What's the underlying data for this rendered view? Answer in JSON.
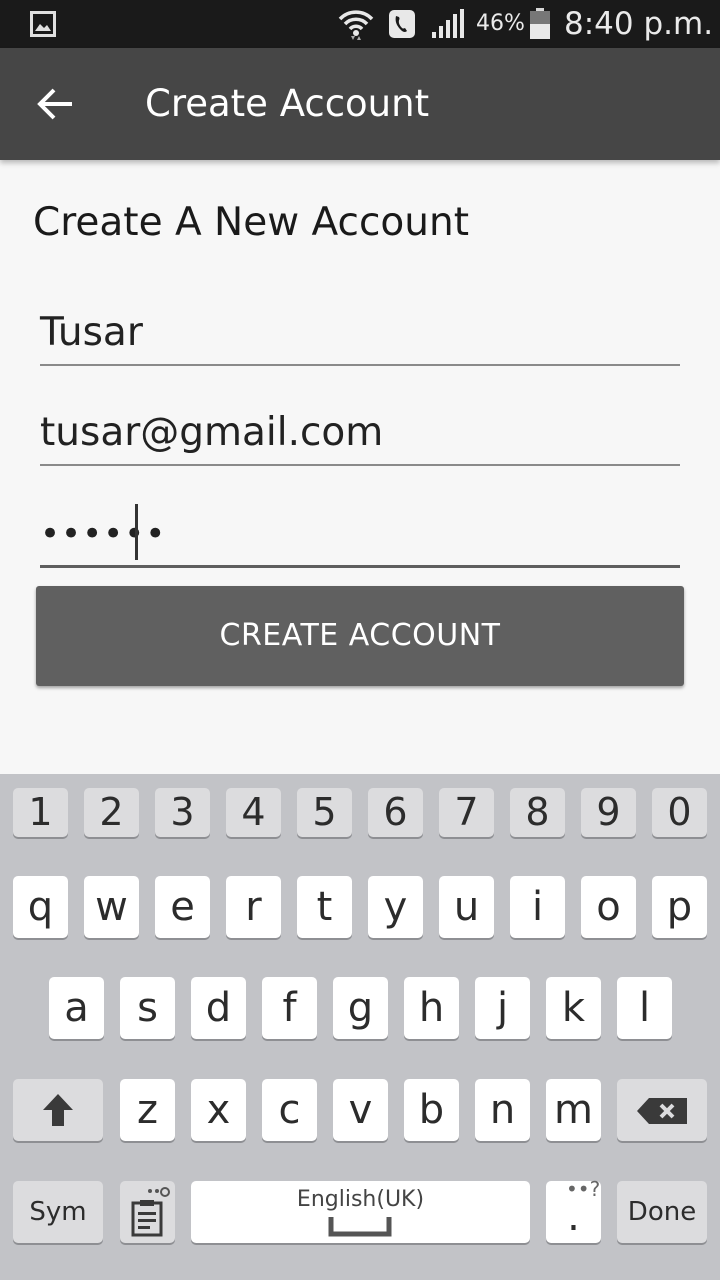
{
  "status_bar": {
    "battery_percent": "46%",
    "time": "8:40 p.m."
  },
  "app_bar": {
    "title": "Create Account"
  },
  "form": {
    "heading": "Create A New Account",
    "name_value": "Tusar",
    "email_value": "tusar@gmail.com",
    "password_value": "••••••",
    "submit_label": "CREATE ACCOUNT"
  },
  "keyboard": {
    "number_row": [
      "1",
      "2",
      "3",
      "4",
      "5",
      "6",
      "7",
      "8",
      "9",
      "0"
    ],
    "row1": [
      "q",
      "w",
      "e",
      "r",
      "t",
      "y",
      "u",
      "i",
      "o",
      "p"
    ],
    "row2": [
      "a",
      "s",
      "d",
      "f",
      "g",
      "h",
      "j",
      "k",
      "l"
    ],
    "row3": [
      "z",
      "x",
      "c",
      "v",
      "b",
      "n",
      "m"
    ],
    "sym_label": "Sym",
    "space_label": "English(UK)",
    "period_label": ".",
    "period_hint": "••?",
    "done_label": "Done"
  }
}
